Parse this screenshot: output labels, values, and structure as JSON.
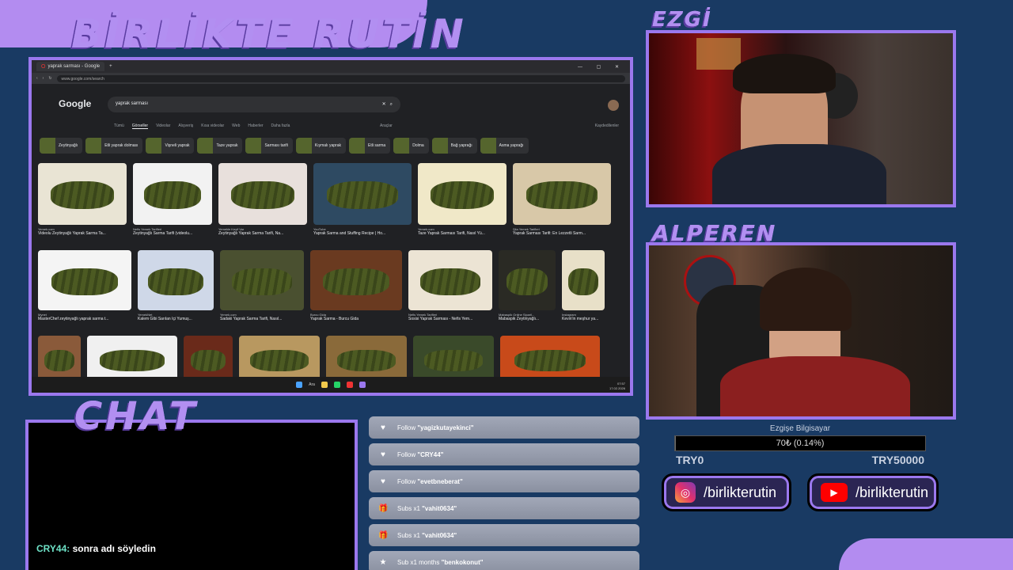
{
  "overlay": {
    "title": "BİRLİKTE RUTİN",
    "cam_top_label": "EZGİ",
    "cam_bottom_label": "ALPEREN",
    "chat_label": "CHAT"
  },
  "browser": {
    "tab_title": "yaprak sarması - Google",
    "url": "www.google.com/search",
    "logo": "Google",
    "query": "yaprak sarması",
    "nav_tabs": [
      "Tümü",
      "Görseller",
      "Videolar",
      "Alışveriş",
      "Kısa videolar",
      "Web",
      "Haberler",
      "Daha fazla"
    ],
    "active_tab": "Görseller",
    "tools": "Araçlar",
    "saved": "Kaydedilenler",
    "chips": [
      "Zeytinyağlı",
      "Etli yaprak dolması",
      "Vişneli yaprak",
      "Taze yaprak",
      "Sarması tarifi",
      "Kıymalı yaprak",
      "Etli sarma",
      "Dolma",
      "Bağ yaprağı",
      "Asma yaprağı"
    ],
    "row1": [
      {
        "source": "Yemek.com",
        "caption": "Videolu Zeytinyağlı Yaprak Sarma Ta..."
      },
      {
        "source": "Nefis Yemek Tarifleri",
        "caption": "Zeytinyağlı Sarma Tarifi (videolu..."
      },
      {
        "source": "Yemekle Keyif Var",
        "caption": "Zeytinyağlı Yaprak Sarma Tarifi, Na..."
      },
      {
        "source": "YouTube",
        "caption": "Yaprak Sarma and Stuffing Recipe | Ho..."
      },
      {
        "source": "Yemek.com",
        "caption": "Taze Yaprak Sarması Tarifi, Nasıl Yü..."
      },
      {
        "source": "Şila Yemek Tarifleri",
        "caption": "Yaprak Sarması Tarifi: En Lezzetli Sarm..."
      }
    ],
    "row2": [
      {
        "source": "Mynet",
        "caption": "MasterChef zeytinyağlı yaprak sarma t..."
      },
      {
        "source": "YemekNet",
        "caption": "Kalem Gibi Sarılan İçi Yumuş..."
      },
      {
        "source": "Yemek.com",
        "caption": "Sadaki Yaprak Sarma Tarifi, Nasıl..."
      },
      {
        "source": "Burcu Gida",
        "caption": "Yaprak Sarma - Burcu Gida"
      },
      {
        "source": "Nefis Yemek Tarifleri",
        "caption": "Sosisi Yaprak Sarması - Nefis Yem..."
      },
      {
        "source": "Mabaspik Online Siparil...",
        "caption": "Mabaspik Zeytinyağlı..."
      },
      {
        "source": "Instagram",
        "caption": "Kevin'in meşhur ya..."
      }
    ],
    "taskbar_search": "Ara",
    "clock_time": "07:57",
    "clock_date": "17.02.2026"
  },
  "chat": {
    "messages": [
      {
        "user": "CRY44:",
        "text": "sonra adı söyledin"
      }
    ]
  },
  "alerts": [
    {
      "icon": "heart-icon",
      "glyph": "♥",
      "prefix": "Follow",
      "name": "\"yagizkutayekinci\""
    },
    {
      "icon": "heart-icon",
      "glyph": "♥",
      "prefix": "Follow",
      "name": "\"CRY44\""
    },
    {
      "icon": "heart-icon",
      "glyph": "♥",
      "prefix": "Follow",
      "name": "\"evetbneberat\""
    },
    {
      "icon": "gift-icon",
      "glyph": "🎁",
      "prefix": "Subs x1",
      "name": "\"vahit0634\""
    },
    {
      "icon": "gift-icon",
      "glyph": "🎁",
      "prefix": "Subs x1",
      "name": "\"vahit0634\""
    },
    {
      "icon": "star-icon",
      "glyph": "★",
      "prefix": "Sub x1 months",
      "name": "\"benkokonut\""
    }
  ],
  "goal": {
    "title": "Ezgişe Bilgisayar",
    "current": "70₺ (0.14%)",
    "progress_fraction": 0.0014,
    "min": "TRY0",
    "max": "TRY50000"
  },
  "socials": {
    "instagram": "/birlikterutin",
    "youtube": "/birlikterutin"
  },
  "colors": {
    "accent": "#9b78ee",
    "background": "#193a63"
  }
}
